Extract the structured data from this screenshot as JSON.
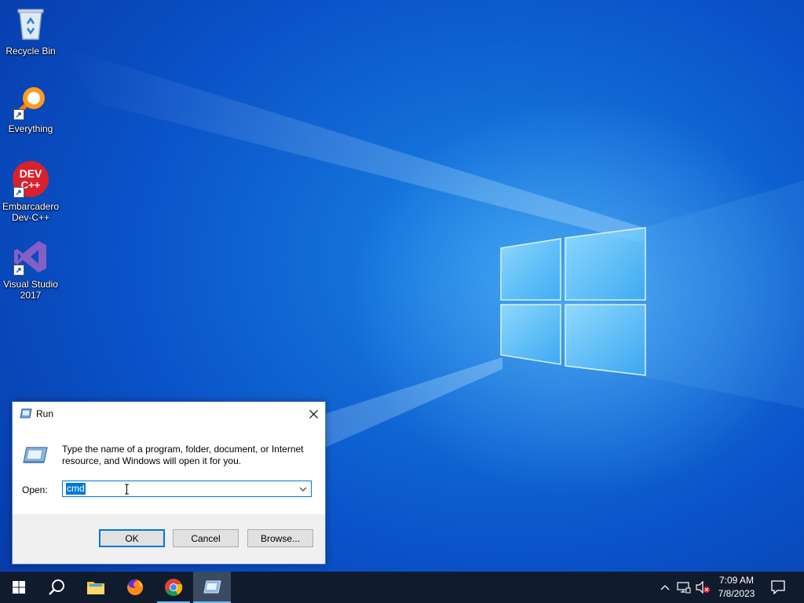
{
  "desktop": {
    "icons": [
      {
        "label": "Recycle Bin"
      },
      {
        "label": "Everything"
      },
      {
        "label": "Embarcadero Dev-C++",
        "icon_text_1": "DEV",
        "icon_text_2": "C++"
      },
      {
        "label": "Visual Studio 2017"
      }
    ]
  },
  "run_dialog": {
    "title": "Run",
    "description": "Type the name of a program, folder, document, or Internet resource, and Windows will open it for you.",
    "open_label": "Open:",
    "open_value": "cmd",
    "ok_label": "OK",
    "cancel_label": "Cancel",
    "browse_label": "Browse..."
  },
  "taskbar": {
    "items": [
      "start-icon",
      "search-icon",
      "file-explorer-icon",
      "firefox-icon",
      "chrome-icon",
      "run-icon"
    ],
    "time": "7:09 AM",
    "date": "7/8/2023"
  },
  "colors": {
    "desktop_blue": "#0a52c8",
    "taskbar": "#101c2e",
    "accent": "#0078d7"
  }
}
